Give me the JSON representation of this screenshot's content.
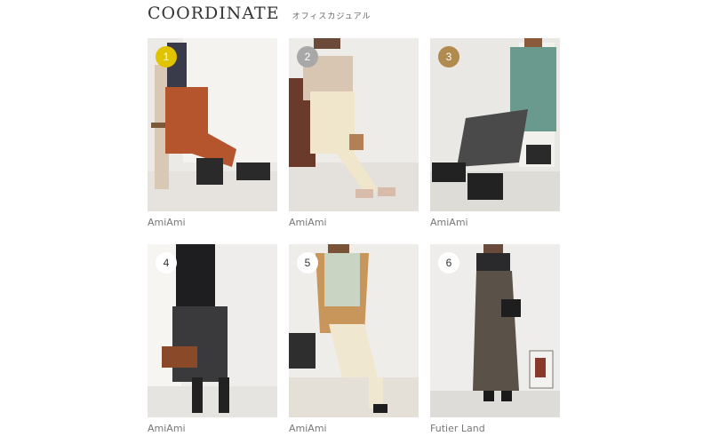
{
  "header": {
    "title": "COORDINATE",
    "subtitle": "オフィスカジュアル"
  },
  "colors": {
    "gold": "#e0c400",
    "silver": "#a8a8a8",
    "bronze": "#b08a4e",
    "plain_badge_bg": "#ffffff",
    "plain_badge_text": "#333333"
  },
  "coordinates": [
    {
      "rank": "1",
      "brand": "AmiAmi",
      "badge_style": "gold"
    },
    {
      "rank": "2",
      "brand": "AmiAmi",
      "badge_style": "silver"
    },
    {
      "rank": "3",
      "brand": "AmiAmi",
      "badge_style": "bronze"
    },
    {
      "rank": "4",
      "brand": "AmiAmi",
      "badge_style": "plain"
    },
    {
      "rank": "5",
      "brand": "AmiAmi",
      "badge_style": "plain"
    },
    {
      "rank": "6",
      "brand": "Futier Land",
      "badge_style": "plain"
    }
  ]
}
